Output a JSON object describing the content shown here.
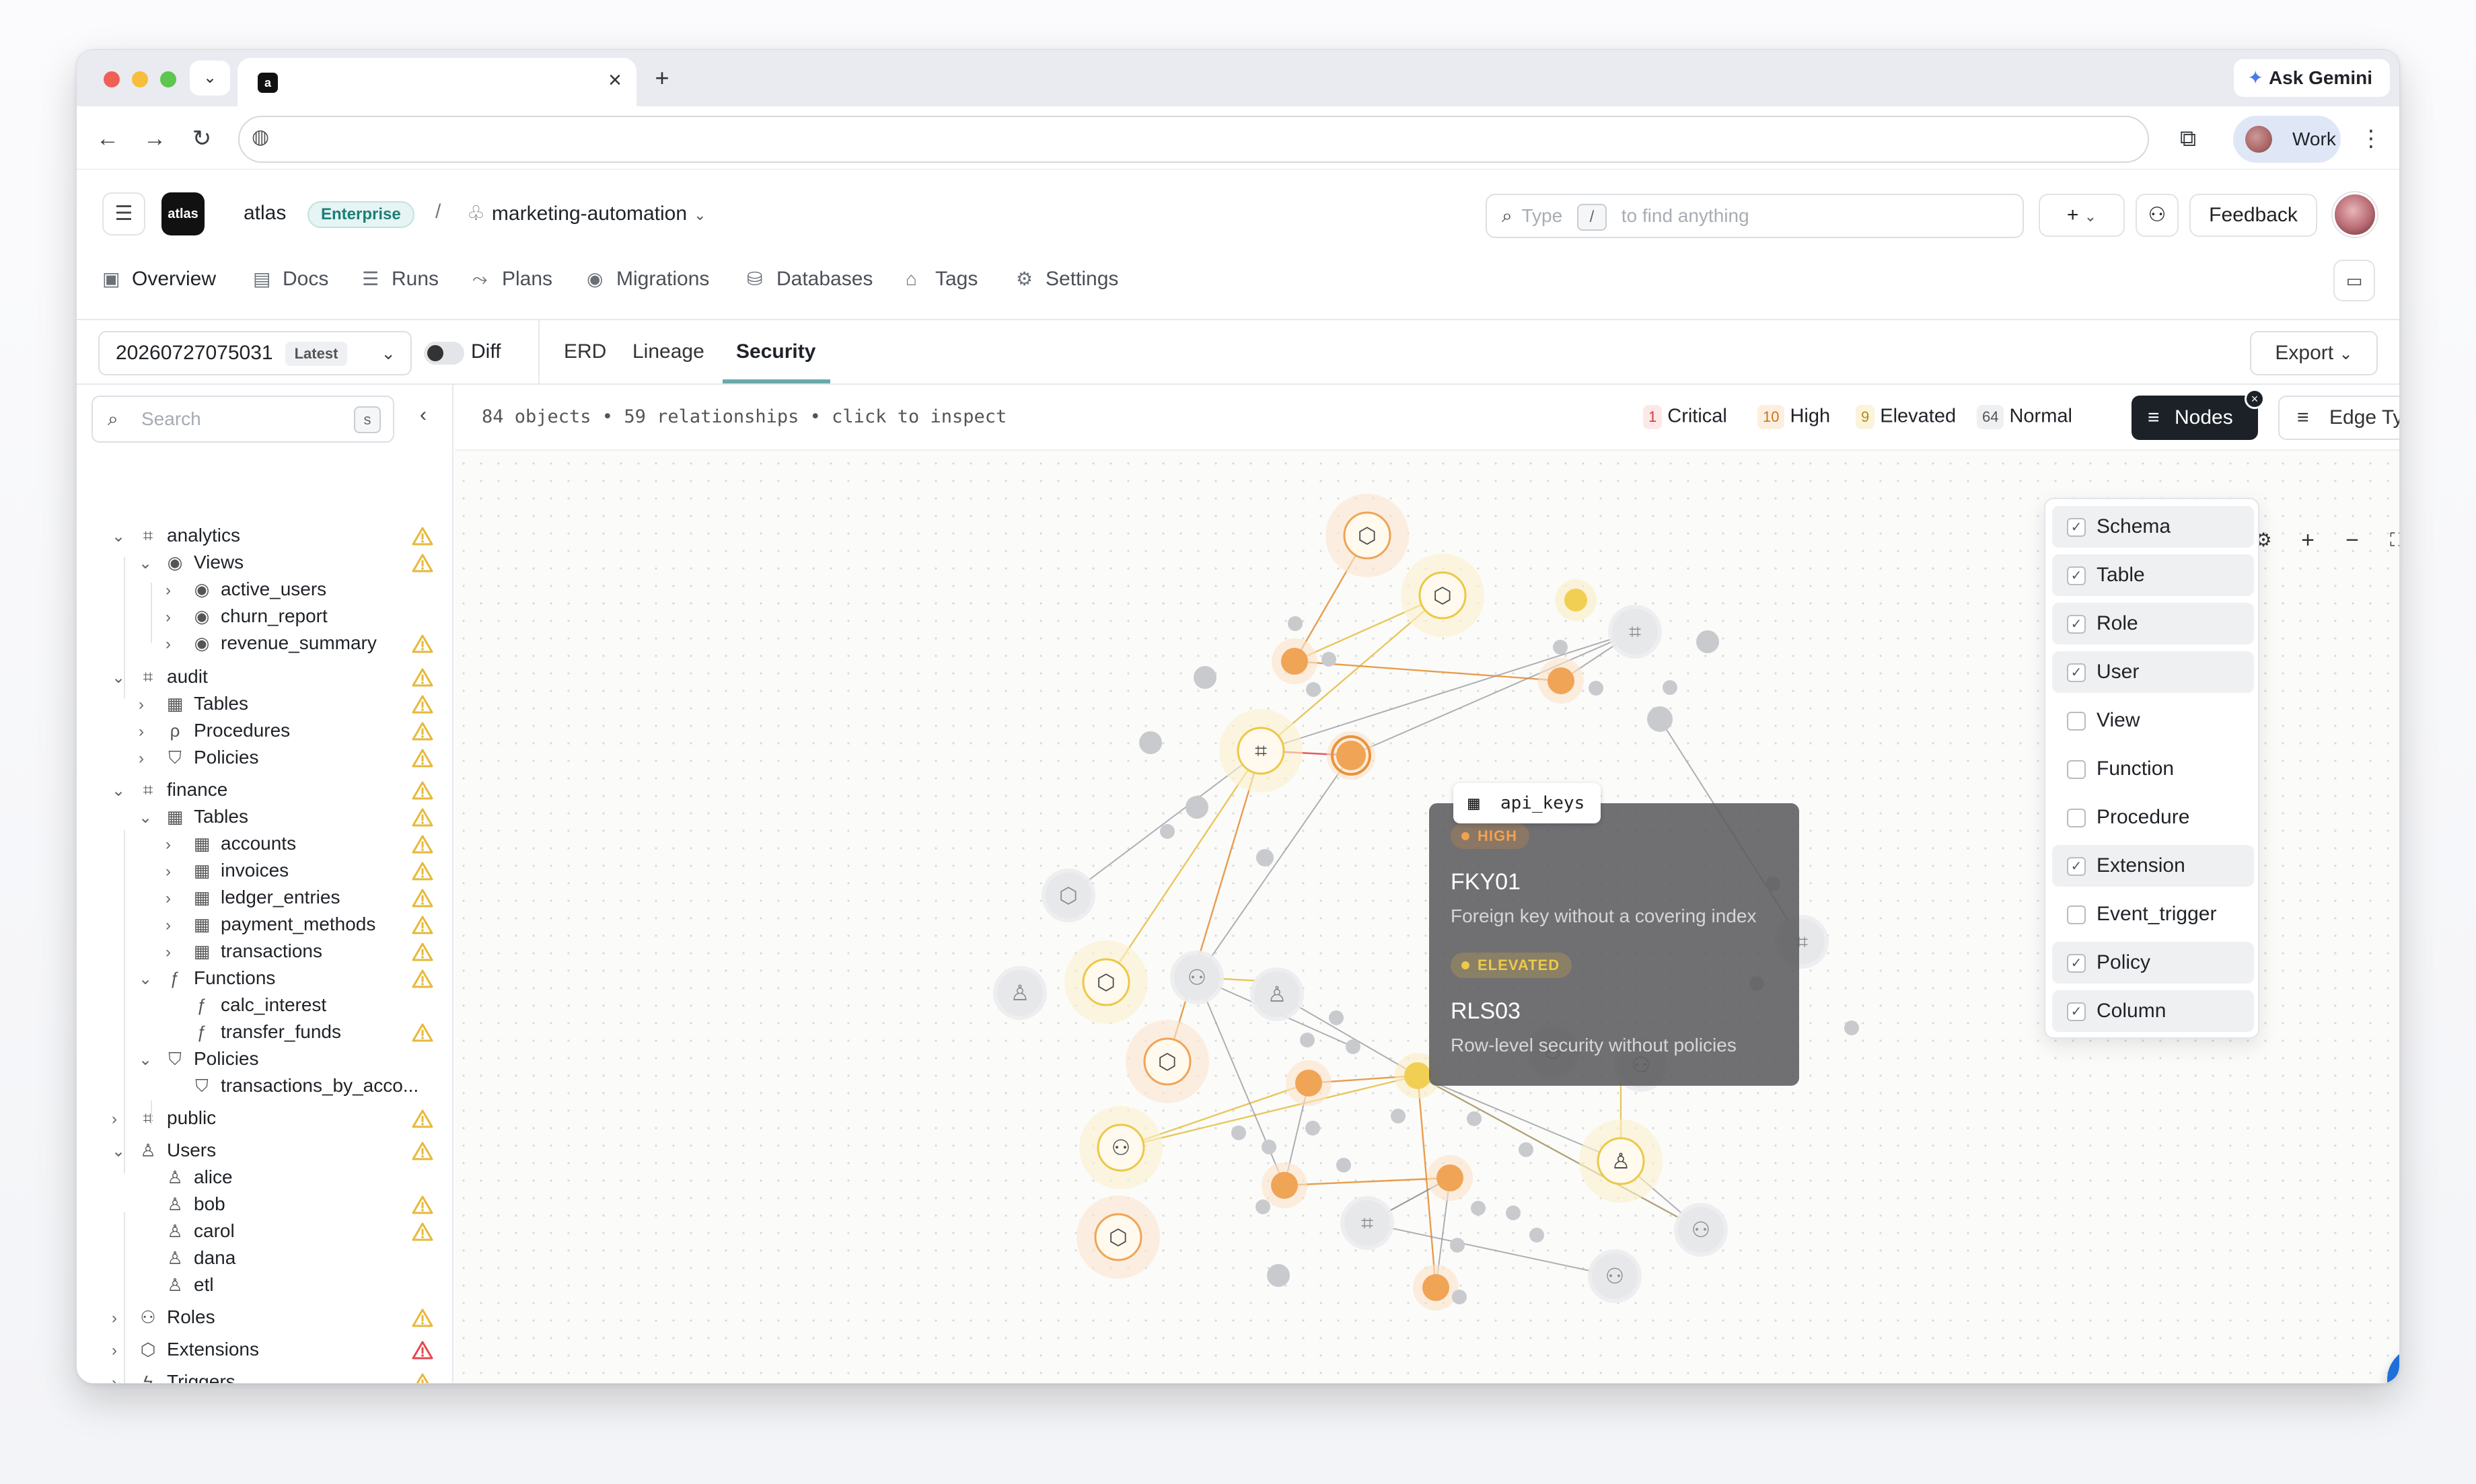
{
  "browser": {
    "tab_favicon": "a",
    "new_tab_icon": "plus-icon",
    "gemini_label": "Ask Gemini",
    "profile_label": "Work"
  },
  "app": {
    "logo_text": "atlas",
    "workspace": "atlas",
    "plan_badge": "Enterprise",
    "separator": "/",
    "project": "marketing-automation",
    "search": {
      "prefix": "Type",
      "key": "/",
      "suffix": "to find anything"
    },
    "feedback_label": "Feedback"
  },
  "nav": {
    "tabs": [
      {
        "label": "Overview",
        "icon": "overview-icon"
      },
      {
        "label": "Docs",
        "icon": "book-icon"
      },
      {
        "label": "Runs",
        "icon": "list-icon"
      },
      {
        "label": "Plans",
        "icon": "route-icon"
      },
      {
        "label": "Migrations",
        "icon": "play-circle-icon"
      },
      {
        "label": "Databases",
        "icon": "database-icon"
      },
      {
        "label": "Tags",
        "icon": "tag-icon"
      },
      {
        "label": "Settings",
        "icon": "gear-icon"
      }
    ]
  },
  "subbar": {
    "version": "20260727075031",
    "version_badge": "Latest",
    "diff_label": "Diff",
    "views": [
      "ERD",
      "Lineage",
      "Security"
    ],
    "export_label": "Export"
  },
  "sidebar": {
    "search_placeholder": "Search",
    "search_key": "s",
    "tree": [
      {
        "label": "analytics",
        "icon": "schema-icon",
        "warn": "yellow"
      },
      {
        "label": "Views",
        "icon": "eye-icon",
        "warn": "yellow"
      },
      {
        "label": "active_users",
        "icon": "eye-icon",
        "warn": ""
      },
      {
        "label": "churn_report",
        "icon": "eye-icon",
        "warn": ""
      },
      {
        "label": "revenue_summary",
        "icon": "eye-icon",
        "warn": "yellow"
      },
      {
        "label": "audit",
        "icon": "schema-icon",
        "warn": "yellow"
      },
      {
        "label": "Tables",
        "icon": "table-icon",
        "warn": "yellow"
      },
      {
        "label": "Procedures",
        "icon": "procedure-icon",
        "warn": "yellow"
      },
      {
        "label": "Policies",
        "icon": "shield-icon",
        "warn": "yellow"
      },
      {
        "label": "finance",
        "icon": "schema-icon",
        "warn": "yellow"
      },
      {
        "label": "Tables",
        "icon": "table-icon",
        "warn": "yellow"
      },
      {
        "label": "accounts",
        "icon": "table-icon",
        "warn": "yellow"
      },
      {
        "label": "invoices",
        "icon": "table-icon",
        "warn": "yellow"
      },
      {
        "label": "ledger_entries",
        "icon": "table-icon",
        "warn": "yellow"
      },
      {
        "label": "payment_methods",
        "icon": "table-icon",
        "warn": "yellow"
      },
      {
        "label": "transactions",
        "icon": "table-icon",
        "warn": "yellow"
      },
      {
        "label": "Functions",
        "icon": "function-icon",
        "warn": "yellow"
      },
      {
        "label": "calc_interest",
        "icon": "function-icon",
        "warn": ""
      },
      {
        "label": "transfer_funds",
        "icon": "function-icon",
        "warn": "yellow"
      },
      {
        "label": "Policies",
        "icon": "shield-icon",
        "warn": ""
      },
      {
        "label": "transactions_by_acco...",
        "icon": "shield-icon",
        "warn": ""
      },
      {
        "label": "public",
        "icon": "schema-icon",
        "warn": "yellow"
      },
      {
        "label": "Users",
        "icon": "user-icon",
        "warn": "yellow"
      },
      {
        "label": "alice",
        "icon": "user-icon",
        "warn": ""
      },
      {
        "label": "bob",
        "icon": "user-icon",
        "warn": "yellow"
      },
      {
        "label": "carol",
        "icon": "user-icon",
        "warn": "yellow"
      },
      {
        "label": "dana",
        "icon": "user-icon",
        "warn": ""
      },
      {
        "label": "etl",
        "icon": "user-icon",
        "warn": ""
      },
      {
        "label": "Roles",
        "icon": "roles-icon",
        "warn": "yellow"
      },
      {
        "label": "Extensions",
        "icon": "package-icon",
        "warn": "red"
      },
      {
        "label": "Triggers",
        "icon": "bolt-icon",
        "warn": "yellow"
      }
    ]
  },
  "canvas": {
    "summary": "84 objects • 59 relationships • click to inspect",
    "severity": [
      {
        "count": "1",
        "label": "Critical",
        "color": "#e5484d"
      },
      {
        "count": "10",
        "label": "High",
        "color": "#e8933a"
      },
      {
        "count": "9",
        "label": "Elevated",
        "color": "#e2b93b"
      },
      {
        "count": "64",
        "label": "Normal",
        "color": "#8b9098"
      }
    ],
    "nodes_label": "Nodes",
    "edge_types_label": "Edge Types",
    "node_filter": [
      {
        "label": "Schema",
        "checked": true
      },
      {
        "label": "Table",
        "checked": true
      },
      {
        "label": "Role",
        "checked": true
      },
      {
        "label": "User",
        "checked": true
      },
      {
        "label": "View",
        "checked": false
      },
      {
        "label": "Function",
        "checked": false
      },
      {
        "label": "Procedure",
        "checked": false
      },
      {
        "label": "Extension",
        "checked": true
      },
      {
        "label": "Event_trigger",
        "checked": false
      },
      {
        "label": "Policy",
        "checked": true
      },
      {
        "label": "Column",
        "checked": true
      }
    ],
    "tooltip": {
      "object": "api_keys",
      "findings": [
        {
          "severity": "HIGH",
          "code": "FKY01",
          "description": "Foreign key without a covering index",
          "color": "#e8933a"
        },
        {
          "severity": "ELEVATED",
          "code": "RLS03",
          "description": "Row-level security without policies",
          "color": "#e2b93b"
        }
      ]
    }
  }
}
